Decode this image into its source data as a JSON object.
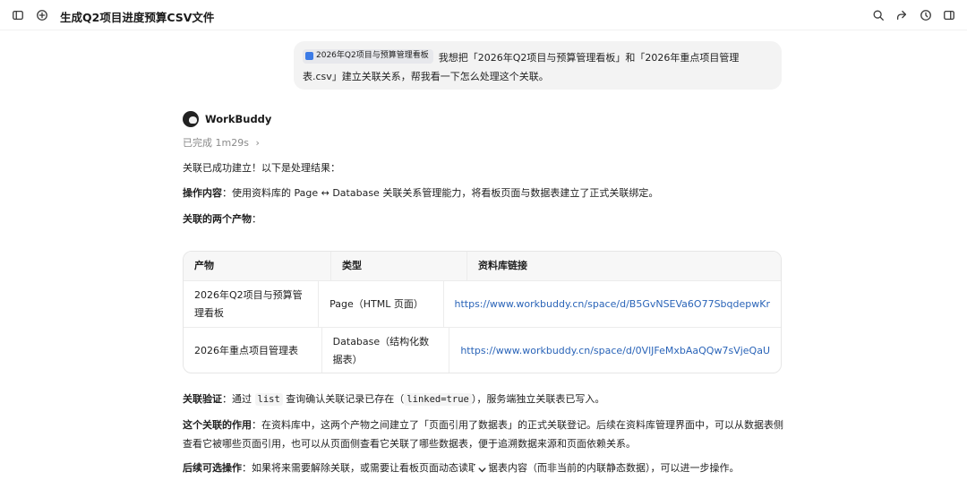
{
  "header": {
    "title": "生成Q2项目进度预算CSV文件",
    "icons": [
      "sidebar-toggle-icon",
      "new-chat-icon",
      "search-icon",
      "share-icon",
      "history-icon",
      "panel-icon"
    ]
  },
  "user_message": {
    "attachment": "2026年Q2项目与预算管理看板",
    "text": "我想把「2026年Q2项目与预算管理看板」和「2026年重点项目管理表.csv」建立关联关系，帮我看一下怎么处理这个关联。"
  },
  "assistant": {
    "name": "WorkBuddy",
    "status": "已完成 1m29s",
    "intro": "关联已成功建立！以下是处理结果：",
    "op_label": "操作内容",
    "op_text": "：使用资料库的 Page ↔ Database 关联关系管理能力，将看板页面与数据表建立了正式关联绑定。",
    "products_label": "关联的两个产物",
    "products_colon": "：",
    "table": {
      "headers": [
        "产物",
        "类型",
        "资料库链接"
      ],
      "rows": [
        [
          "2026年Q2项目与预算管理看板",
          "Page（HTML 页面）",
          "https://www.workbuddy.cn/space/d/B5GvNSEVa6O77SbqdepwKr"
        ],
        [
          "2026年重点项目管理表",
          "Database（结构化数据表）",
          "https://www.workbuddy.cn/space/d/0VlJFeMxbAaQQw7sVjeQaU"
        ]
      ]
    },
    "verify_label": "关联验证",
    "verify_pre": "：通过 ",
    "verify_code1": "list",
    "verify_mid": " 查询确认关联记录已存在（",
    "verify_code2": "linked=true",
    "verify_post": "），服务端独立关联表已写入。",
    "effect_label": "这个关联的作用",
    "effect_text": "：在资料库中，这两个产物之间建立了「页面引用了数据表」的正式关联登记。后续在资料库管理界面中，可以从数据表侧查看它被哪些页面引用，也可以从页面侧查看它关联了哪些数据表，便于追溯数据来源和页面依赖关系。",
    "next_label": "后续可选操作",
    "next_text": "：如果将来需要解除关联，或需要让看板页面动态读取数据表内容（而非当前的内联静态数据），可以进一步操作。"
  }
}
